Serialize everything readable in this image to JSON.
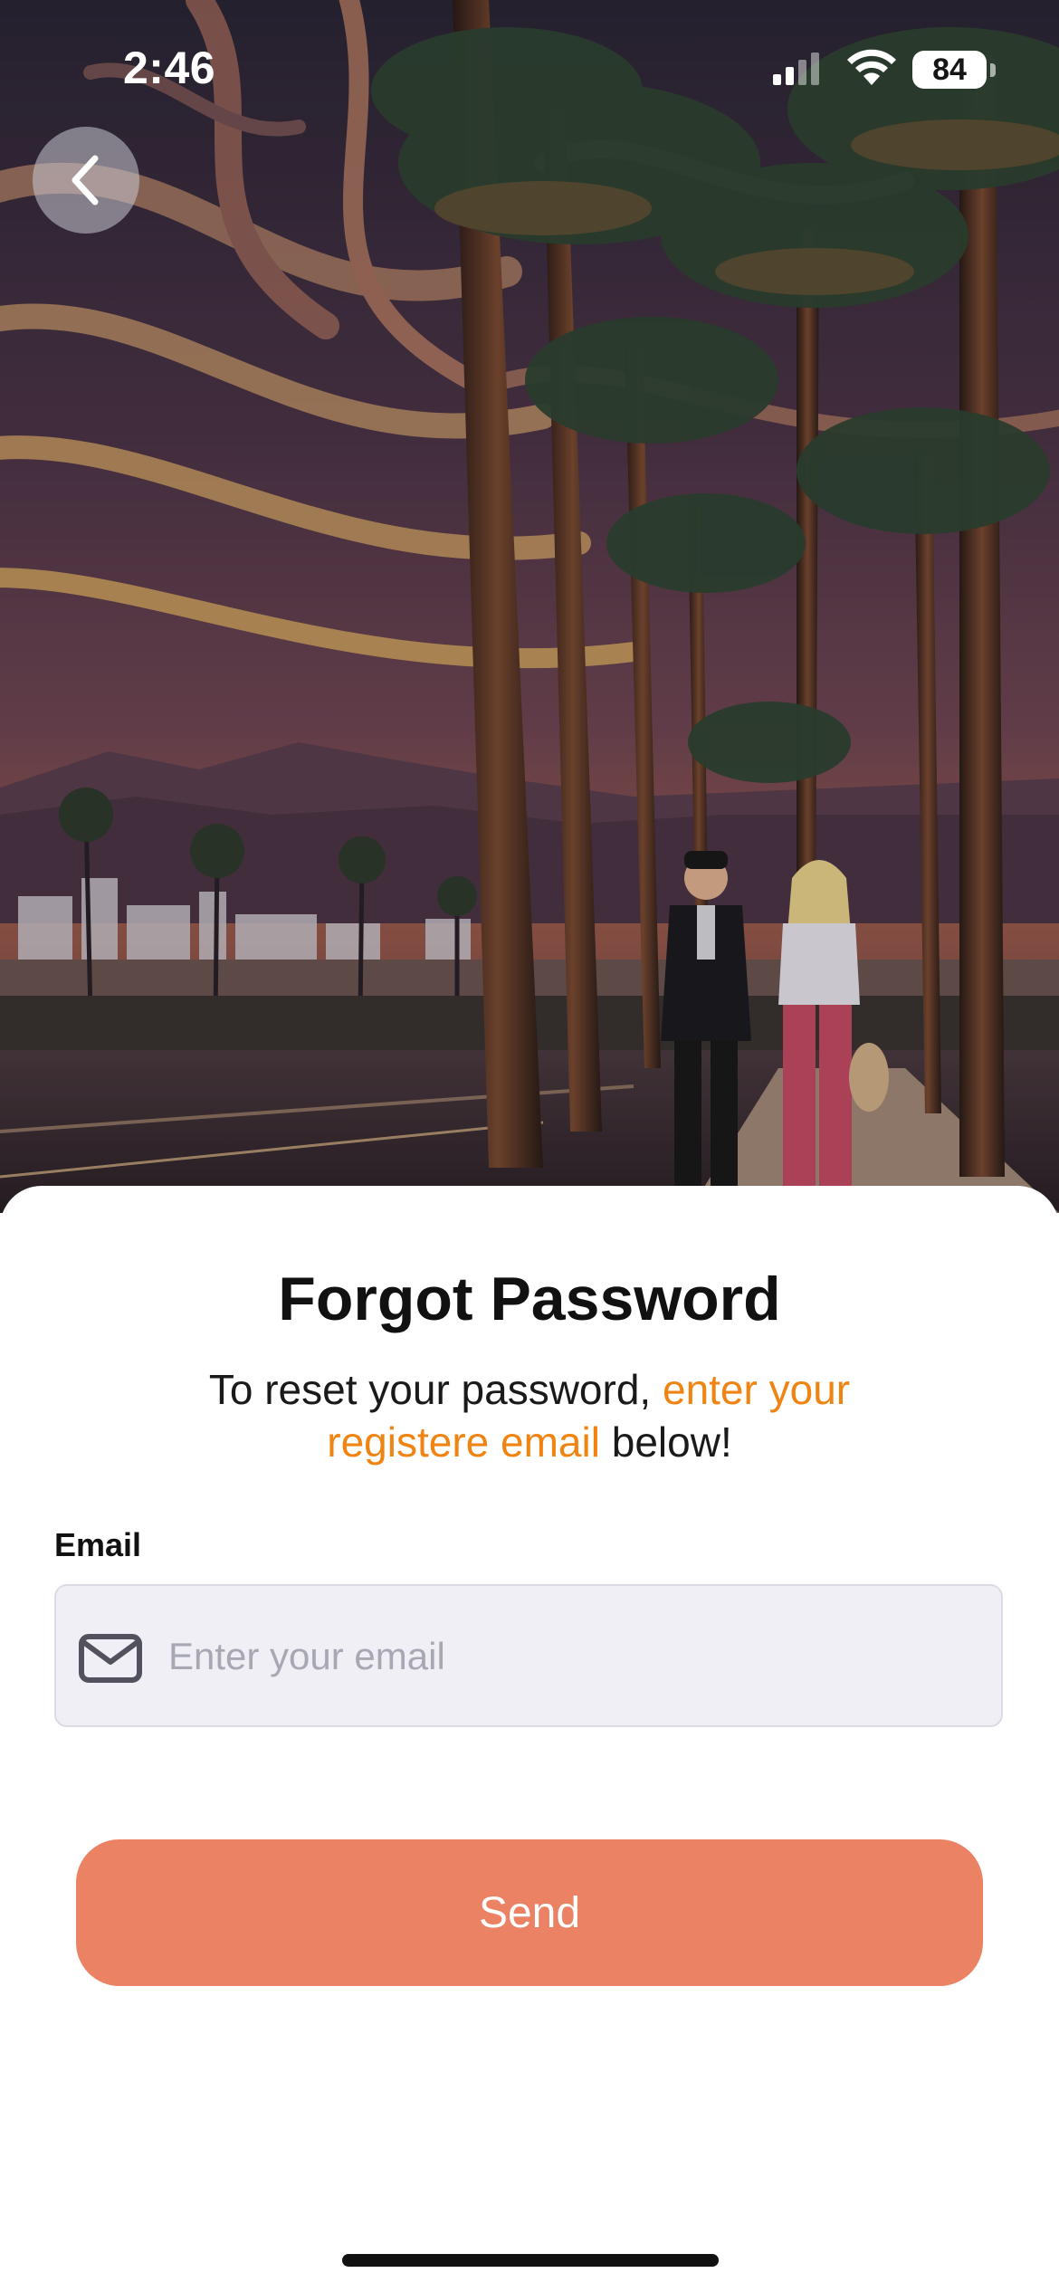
{
  "status_bar": {
    "time": "2:46",
    "battery_level": "84",
    "icons": [
      "signal-icon",
      "wifi-icon",
      "battery-icon"
    ]
  },
  "navigation": {
    "back_icon": "chevron-left-icon"
  },
  "hero": {
    "description_icon": "palm-boulevard-illustration"
  },
  "form": {
    "title": "Forgot Password",
    "subtitle_lead": "To reset your password, ",
    "subtitle_accent": "enter your registere email",
    "subtitle_tail": " below!",
    "email_label": "Email",
    "email_placeholder": "Enter your email",
    "email_value": "",
    "email_icon": "mail-icon",
    "send_label": "Send"
  },
  "colors": {
    "accent_text": "#f08412",
    "button": "#ea8263",
    "field_bg": "#f0eff6"
  }
}
